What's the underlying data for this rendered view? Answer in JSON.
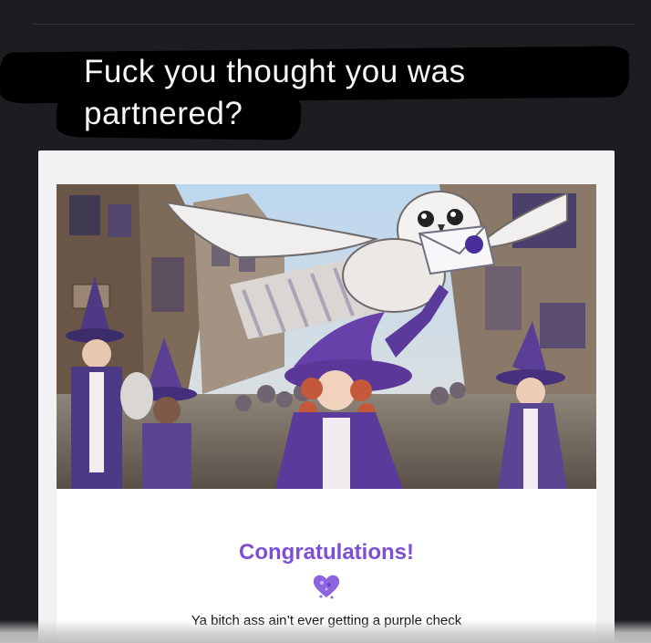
{
  "post": {
    "caption": "Fuck you thought you was partnered?"
  },
  "card": {
    "heading": "Congratulations!",
    "icon": "purple-heart-badge-icon",
    "message": "Ya bitch ass ain’t ever getting a purple check",
    "accent_color": "#7d4fd6"
  },
  "hero_image": {
    "description_icon": "witches-and-owl-illustration"
  }
}
